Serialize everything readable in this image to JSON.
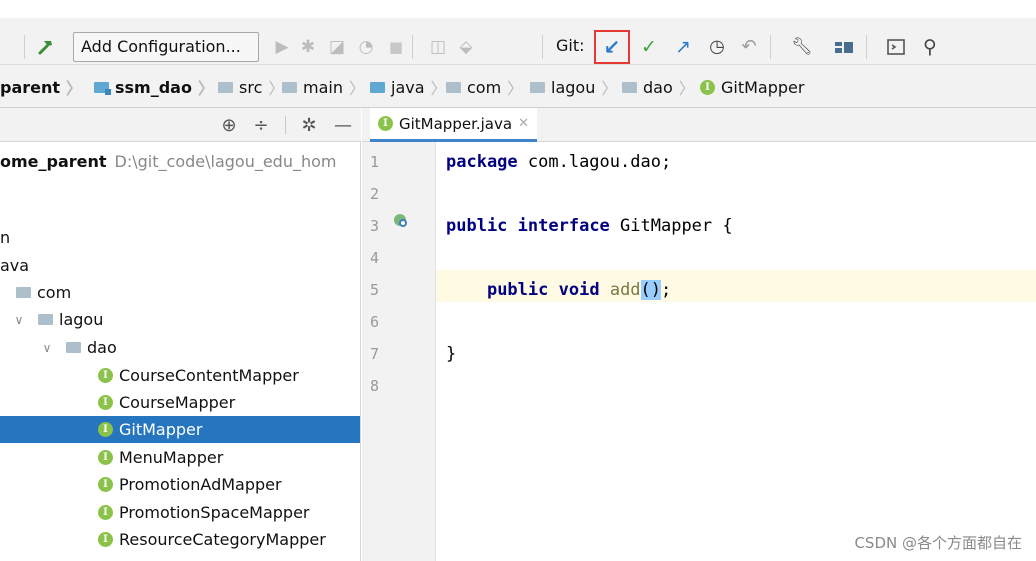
{
  "toolbar": {
    "add_configuration_label": "Add Configuration...",
    "git_label": "Git:",
    "icons": [
      "hammer-icon",
      "run-icon",
      "debug-icon",
      "coverage-icon",
      "profile-icon",
      "stop-icon",
      "attach-icon",
      "build-artifacts-icon",
      "git-update-icon",
      "git-commit-icon",
      "git-push-icon",
      "git-history-icon",
      "git-rollback-icon",
      "settings-wrench-icon",
      "project-structure-icon",
      "terminal-icon",
      "search-icon"
    ]
  },
  "breadcrumb": {
    "items": [
      "parent",
      "ssm_dao",
      "src",
      "main",
      "java",
      "com",
      "lagou",
      "dao",
      "GitMapper"
    ]
  },
  "project": {
    "root_name": "ome_parent",
    "root_path": "D:\\git_code\\lagou_edu_hom",
    "rows": [
      {
        "label": "n"
      },
      {
        "label": "ava"
      },
      {
        "label": "com"
      },
      {
        "label": "lagou"
      },
      {
        "label": "dao"
      },
      {
        "label": "CourseContentMapper"
      },
      {
        "label": "CourseMapper"
      },
      {
        "label": "GitMapper"
      },
      {
        "label": "MenuMapper"
      },
      {
        "label": "PromotionAdMapper"
      },
      {
        "label": "PromotionSpaceMapper"
      },
      {
        "label": "ResourceCategoryMapper"
      }
    ],
    "selected": "GitMapper"
  },
  "editor": {
    "tab_label": "GitMapper.java",
    "line_numbers": [
      "1",
      "2",
      "3",
      "4",
      "5",
      "6",
      "7",
      "8"
    ],
    "code": {
      "l1_kw": "package",
      "l1_rest": " com.lagou.dao;",
      "l3_kw1": "public",
      "l3_kw2": "interface",
      "l3_rest": " GitMapper {",
      "l5_kw1": "public",
      "l5_kw2": "void",
      "l5_method": "add",
      "l5_paren": "()",
      "l5_end": ";",
      "l7": "}"
    }
  },
  "watermark": "CSDN @各个方面都自在",
  "colors": {
    "selection": "#2675bf",
    "highlight_box": "#e53935",
    "keyword": "#000080"
  }
}
